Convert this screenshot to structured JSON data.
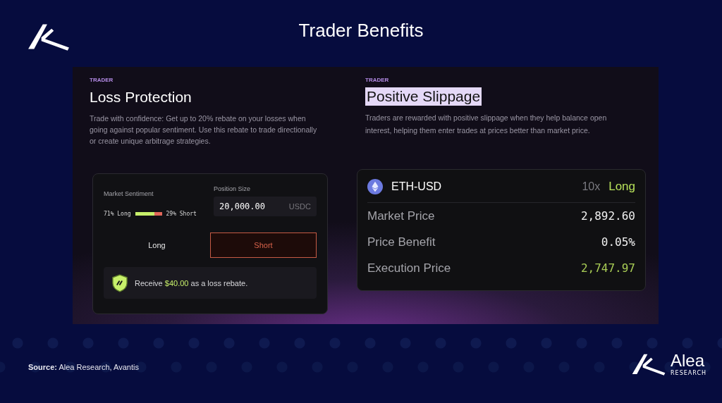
{
  "slide": {
    "title": "Trader Benefits",
    "source_label": "Source:",
    "source_text": "Alea Research, Avantis",
    "logo_name": "Alea",
    "logo_sub": "RESEARCH"
  },
  "loss_protection": {
    "eyebrow": "TRADER",
    "title": "Loss Protection",
    "description": "Trade with confidence: Get up to 20% rebate on your losses when going against popular sentiment. Use this rebate to trade directionally or create unique arbitrage strategies.",
    "widget": {
      "sentiment_label": "Market Sentiment",
      "long_text": "71% Long",
      "short_text": "29% Short",
      "level": 0.71,
      "position_label": "Position Size",
      "position_value": "20,000.00",
      "position_unit": "USDC",
      "sides": [
        {
          "label": "Long",
          "selected": false
        },
        {
          "label": "Short",
          "selected": true
        }
      ],
      "rebate": "Receive **$40.00** as a loss rebate."
    }
  },
  "positive_slippage": {
    "eyebrow": "TRADER",
    "title": "Positive Slippage",
    "title_highlighted": true,
    "description": "Traders are rewarded with positive slippage when they help balance open interest, helping them enter trades at prices better than market price.",
    "card": {
      "pair": "ETH-USD",
      "leverage": "10x",
      "side": "Long",
      "rows": [
        {
          "label": "Market Price",
          "value": "2,892.60",
          "accent": false
        },
        {
          "label": "Price Benefit",
          "value": "0.05%",
          "accent": false
        },
        {
          "label": "Execution Price",
          "value": "2,747.97",
          "accent": true
        }
      ]
    }
  }
}
